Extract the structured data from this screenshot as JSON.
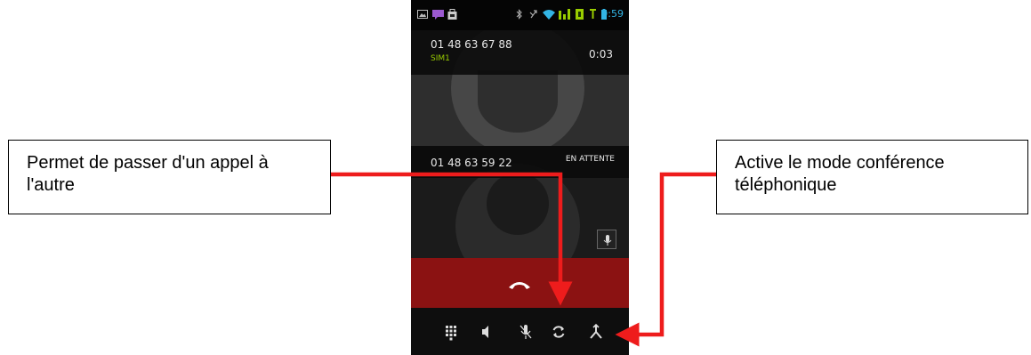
{
  "status_bar": {
    "time": "9:59",
    "icons": [
      "image-icon",
      "chat-icon",
      "shopping-bag-icon",
      "bluetooth-icon",
      "missed-call-icon",
      "wifi-icon",
      "signal-icon",
      "sim-signal-icon",
      "battery-icon"
    ]
  },
  "active_call": {
    "number": "01 48 63 67 88",
    "sim": "SIM1",
    "duration": "0:03"
  },
  "held_call": {
    "number": "01 48 63 59 22",
    "status": "EN ATTENTE"
  },
  "controls": [
    "dialpad-icon",
    "speaker-icon",
    "mute-icon",
    "swap-calls-icon",
    "merge-calls-icon"
  ],
  "annotations": {
    "left": "Permet de passer d'un appel à l'autre",
    "right": "Active le mode conférence téléphonique"
  },
  "colors": {
    "arrow": "#ee1c1c",
    "end_call": "#8b1212",
    "sim_label": "#99cc00",
    "clock": "#33b5e5"
  }
}
